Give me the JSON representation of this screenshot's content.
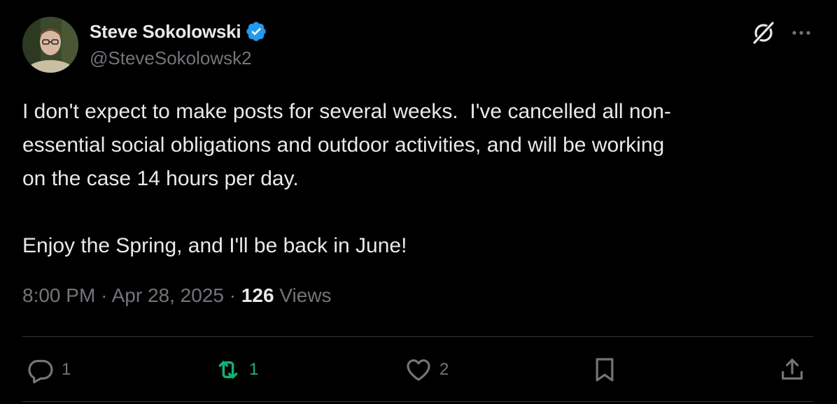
{
  "author": {
    "display_name": "Steve Sokolowski",
    "handle": "@SteveSokolowsk2",
    "verified": true
  },
  "tweet": {
    "text": "I don't expect to make posts for several weeks.  I've cancelled all non-\nessential social obligations and outdoor activities, and will be working\non the case 14 hours per day.\n\nEnjoy the Spring, and I'll be back in June!",
    "time": "8:00 PM",
    "separator": "·",
    "date": "Apr 28, 2025",
    "views_count": "126",
    "views_label": "Views"
  },
  "actions": {
    "reply": {
      "icon": "reply-icon",
      "count": "1"
    },
    "retweet": {
      "icon": "retweet-icon",
      "count": "1",
      "active": true
    },
    "like": {
      "icon": "heart-icon",
      "count": "2"
    },
    "bookmark": {
      "icon": "bookmark-icon"
    },
    "share": {
      "icon": "share-icon"
    }
  },
  "colors": {
    "background": "#000000",
    "text": "#e7e9ea",
    "muted": "#71767b",
    "verified": "#1d9bf0",
    "retweet_active": "#00ba7c",
    "divider": "#2f3336"
  }
}
